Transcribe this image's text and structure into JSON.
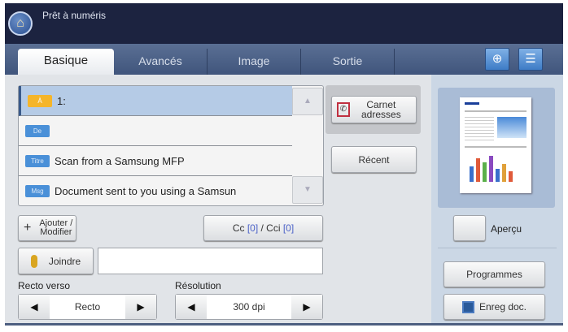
{
  "header": {
    "status": "Prêt à numéris"
  },
  "tabs": [
    {
      "label": "Basique"
    },
    {
      "label": "Avancés"
    },
    {
      "label": "Image"
    },
    {
      "label": "Sortie"
    }
  ],
  "recipients": [
    {
      "badge": "À",
      "value": "1:"
    },
    {
      "badge": "De",
      "value": ""
    },
    {
      "badge": "Titre",
      "value": "Scan from a Samsung MFP"
    },
    {
      "badge": "Msg",
      "value": "Document sent to you using a Samsun"
    }
  ],
  "buttons": {
    "carnet_line1": "Carnet",
    "carnet_line2": "adresses",
    "recent": "Récent",
    "ajouter_line1": "Ajouter /",
    "ajouter_line2": "Modifier",
    "cc_label": "Cc ",
    "cc_count": "[0]",
    "cci_label": " / Cci ",
    "cci_count": "[0]",
    "joindre": "Joindre",
    "apercu": "Aperçu",
    "programmes": "Programmes",
    "enreg": "Enreg doc."
  },
  "attach_field": {
    "value": ""
  },
  "duplex": {
    "label": "Recto verso",
    "value": "Recto"
  },
  "resolution": {
    "label": "Résolution",
    "value": "300 dpi"
  }
}
